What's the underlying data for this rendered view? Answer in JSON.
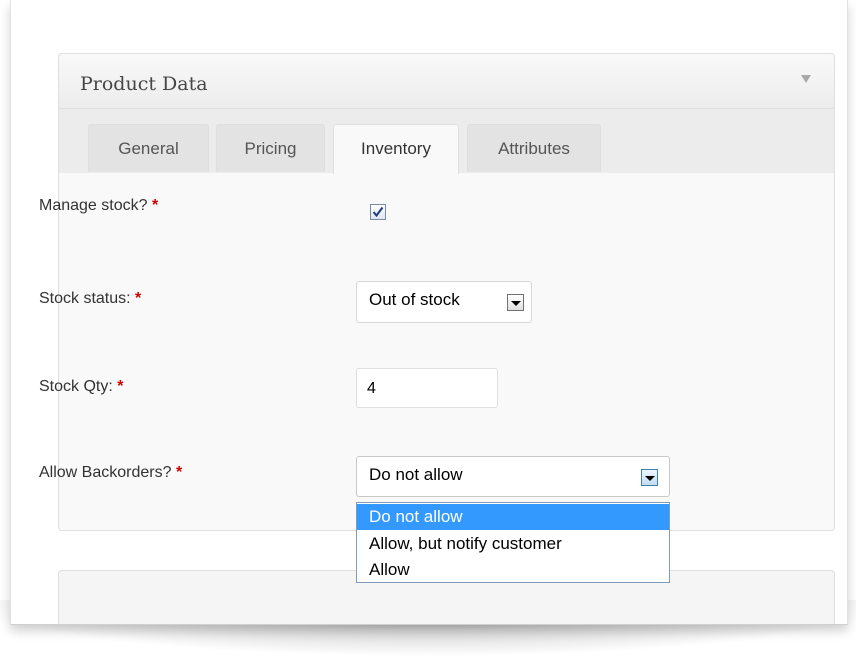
{
  "metabox": {
    "title": "Product Data"
  },
  "tabs": [
    {
      "label": "General",
      "active": false
    },
    {
      "label": "Pricing",
      "active": false
    },
    {
      "label": "Inventory",
      "active": true
    },
    {
      "label": "Attributes",
      "active": false
    }
  ],
  "fields": {
    "manage_stock": {
      "label": "Manage stock?",
      "required_mark": "*",
      "checked": true
    },
    "stock_status": {
      "label": "Stock status:",
      "required_mark": "*",
      "value": "Out of stock"
    },
    "stock_qty": {
      "label": "Stock Qty:",
      "required_mark": "*",
      "value": "4"
    },
    "backorders": {
      "label": "Allow Backorders?",
      "required_mark": "*",
      "value": "Do not allow",
      "options": [
        "Do not allow",
        "Allow, but notify customer",
        "Allow"
      ],
      "highlighted_option": "Do not allow"
    }
  },
  "icons": {
    "toggle": "triangle-down-icon",
    "checkbox_check": "checkmark-icon",
    "select_arrow": "chevron-down-icon"
  },
  "colors": {
    "required": "#d00000",
    "highlight": "#3399ff"
  }
}
